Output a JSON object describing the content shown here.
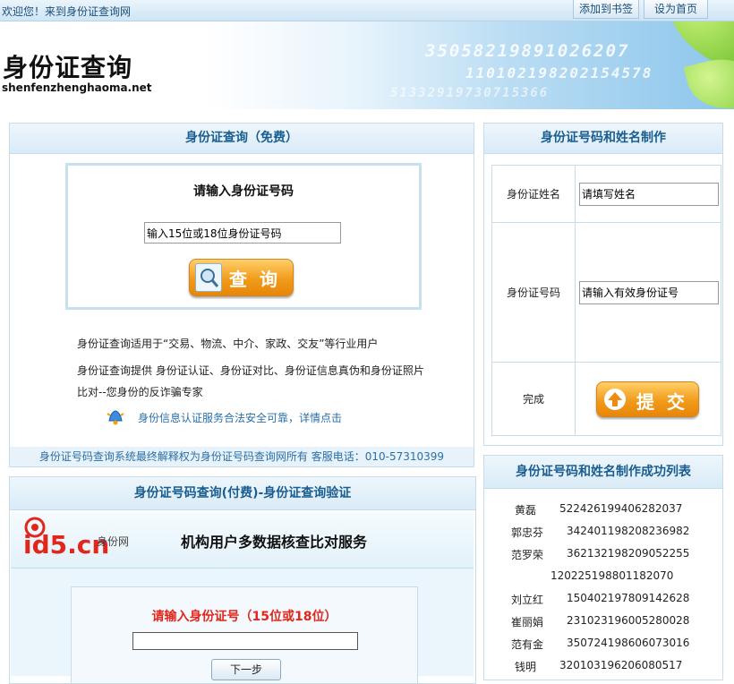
{
  "topbar": {
    "welcome": "欢迎您！来到身份证查询网",
    "bookmark": "添加到书签",
    "homepage": "设为首页"
  },
  "banner": {
    "title": "身份证查询",
    "domain": "shenfenzhenghaoma.net",
    "numbers": [
      "35058219891026207",
      "110102198202154578",
      "51332919730715366"
    ]
  },
  "search": {
    "header": "身份证查询（免费）",
    "box_title": "请输入身份证号码",
    "input_value": "输入15位或18位身份证号码",
    "button": "查询",
    "desc1": "身份证查询适用于“交易、物流、中介、家政、交友”等行业用户",
    "desc2": "身份证查询提供 身份证认证、身份证对比、身份证信息真伪和身份证照片",
    "desc3": "比对--您身份的反诈骗专家",
    "notice": "身份信息认证服务合法安全可靠，详情点击",
    "footer": "身份证号码查询系统最终解释权为身份证号码查询网所有    客服电话：010-57310399"
  },
  "make": {
    "header": "身份证号码和姓名制作",
    "name_label": "身份证姓名",
    "name_value": "请填写姓名",
    "id_label": "身份证号码",
    "id_value": "请输入有效身份证号",
    "done_label": "完成",
    "submit": "提交"
  },
  "success": {
    "header": "身份证号码和姓名制作成功列表",
    "rows": [
      {
        "name": "黄磊",
        "id": "522426199406282037"
      },
      {
        "name": "郭忠芬",
        "id": "342401198208236982"
      },
      {
        "name": "范罗荣",
        "id": "362132198209052255"
      },
      {
        "name": "",
        "id": "120225198801182070"
      },
      {
        "name": "刘立红",
        "id": "150402197809142628"
      },
      {
        "name": "崔丽娟",
        "id": "231023196005280028"
      },
      {
        "name": "范有金",
        "id": "350724198606073016"
      },
      {
        "name": "钱明",
        "id": "320103196206080517"
      }
    ]
  },
  "paid": {
    "header": "身份证号码查询(付费)-身份证查询验证",
    "brand": "id5.cn",
    "brand_sub": "身份网",
    "service": "机构用户多数据核查比对服务",
    "prompt": "请输入身份证号（15位或18位）",
    "next": "下一步"
  }
}
